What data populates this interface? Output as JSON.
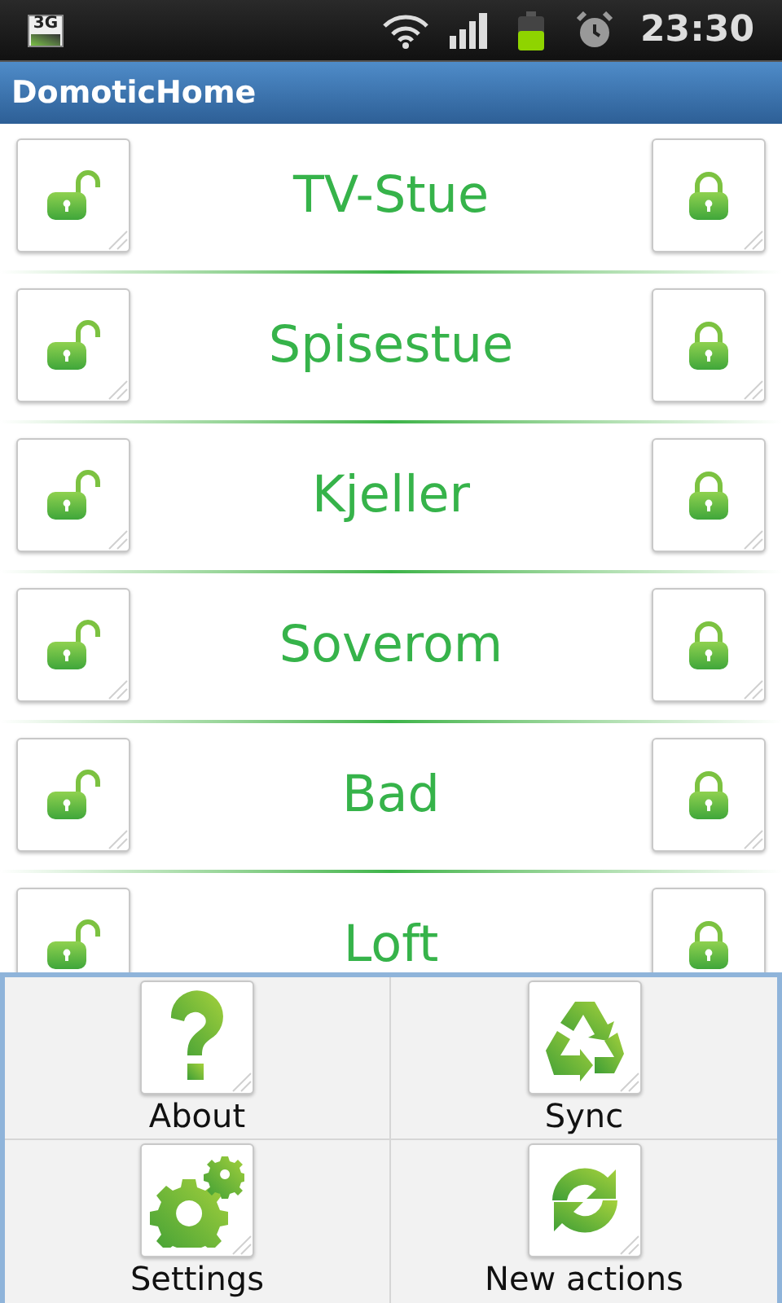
{
  "status_bar": {
    "network": "3G",
    "time": "23:30"
  },
  "title_bar": {
    "title": "DomoticHome"
  },
  "rooms": [
    {
      "name": "TV-Stue"
    },
    {
      "name": "Spisestue"
    },
    {
      "name": "Kjeller"
    },
    {
      "name": "Soverom"
    },
    {
      "name": "Bad"
    },
    {
      "name": "Loft"
    }
  ],
  "menu": [
    {
      "label": "About",
      "kind": "help"
    },
    {
      "label": "Sync",
      "kind": "recycle"
    },
    {
      "label": "Settings",
      "kind": "gears"
    },
    {
      "label": "New actions",
      "kind": "refresh"
    }
  ]
}
